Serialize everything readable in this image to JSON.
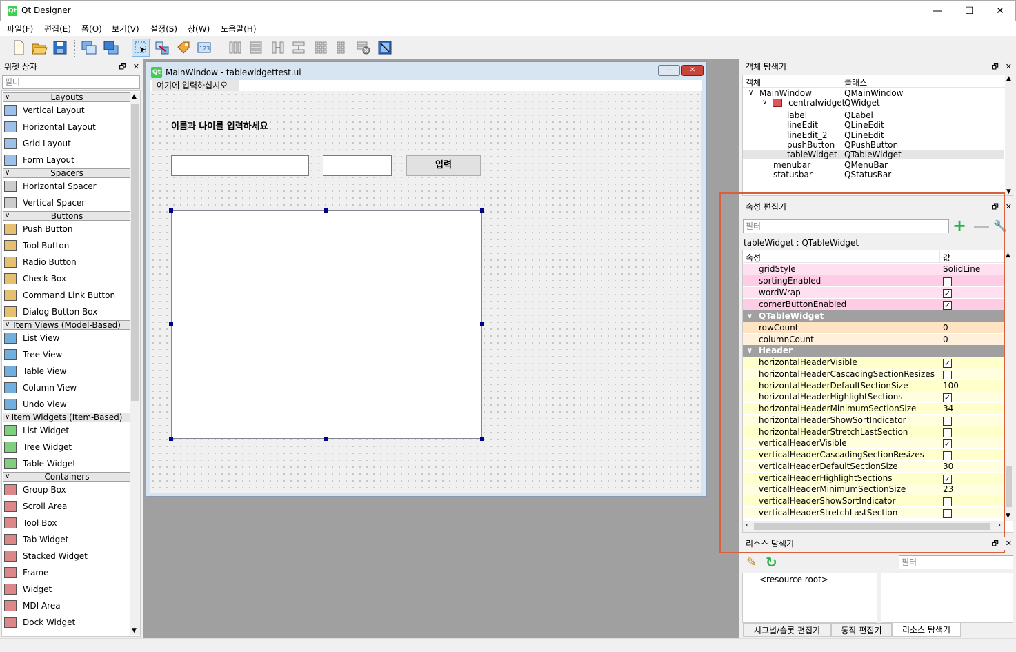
{
  "window": {
    "title": "Qt Designer",
    "min": "—",
    "max": "☐",
    "close": "✕"
  },
  "menu": [
    "파일(F)",
    "편집(E)",
    "폼(O)",
    "보기(V)",
    "설정(S)",
    "창(W)",
    "도움말(H)"
  ],
  "widget_box": {
    "title": "위젯 상자",
    "filter_placeholder": "필터",
    "categories": [
      {
        "label": "Layouts",
        "items": [
          "Vertical Layout",
          "Horizontal Layout",
          "Grid Layout",
          "Form Layout"
        ]
      },
      {
        "label": "Spacers",
        "items": [
          "Horizontal Spacer",
          "Vertical Spacer"
        ]
      },
      {
        "label": "Buttons",
        "items": [
          "Push Button",
          "Tool Button",
          "Radio Button",
          "Check Box",
          "Command Link Button",
          "Dialog Button Box"
        ]
      },
      {
        "label": "Item Views (Model-Based)",
        "items": [
          "List View",
          "Tree View",
          "Table View",
          "Column View",
          "Undo View"
        ]
      },
      {
        "label": "Item Widgets (Item-Based)",
        "items": [
          "List Widget",
          "Tree Widget",
          "Table Widget"
        ]
      },
      {
        "label": "Containers",
        "items": [
          "Group Box",
          "Scroll Area",
          "Tool Box",
          "Tab Widget",
          "Stacked Widget",
          "Frame",
          "Widget",
          "MDI Area",
          "Dock Widget"
        ]
      }
    ]
  },
  "form_window": {
    "title": "MainWindow - tablewidgettest.ui",
    "menu_placeholder": "여기에 입력하십시오",
    "label_text": "이름과 나이를 입력하세요",
    "button_text": "입력"
  },
  "object_inspector": {
    "title": "객체 탐색기",
    "col_object": "객체",
    "col_class": "클래스",
    "rows": [
      {
        "name": "MainWindow",
        "cls": "QMainWindow"
      },
      {
        "name": "centralwidget",
        "cls": "QWidget"
      },
      {
        "name": "label",
        "cls": "QLabel"
      },
      {
        "name": "lineEdit",
        "cls": "QLineEdit"
      },
      {
        "name": "lineEdit_2",
        "cls": "QLineEdit"
      },
      {
        "name": "pushButton",
        "cls": "QPushButton"
      },
      {
        "name": "tableWidget",
        "cls": "QTableWidget"
      },
      {
        "name": "menubar",
        "cls": "QMenuBar"
      },
      {
        "name": "statusbar",
        "cls": "QStatusBar"
      }
    ]
  },
  "property_editor": {
    "title": "속성 편집기",
    "filter_placeholder": "필터",
    "object_label": "tableWidget : QTableWidget",
    "col_property": "속성",
    "col_value": "값",
    "rows_a": [
      {
        "name": "gridStyle",
        "value": "SolidLine"
      },
      {
        "name": "sortingEnabled",
        "value": ""
      },
      {
        "name": "wordWrap",
        "value": "✓"
      },
      {
        "name": "cornerButtonEnabled",
        "value": "✓"
      }
    ],
    "group1": "QTableWidget",
    "rows_b": [
      {
        "name": "rowCount",
        "value": "0"
      },
      {
        "name": "columnCount",
        "value": "0"
      }
    ],
    "group2": "Header",
    "rows_c": [
      {
        "name": "horizontalHeaderVisible",
        "value": "✓"
      },
      {
        "name": "horizontalHeaderCascadingSectionResizes",
        "value": ""
      },
      {
        "name": "horizontalHeaderDefaultSectionSize",
        "value": "100"
      },
      {
        "name": "horizontalHeaderHighlightSections",
        "value": "✓"
      },
      {
        "name": "horizontalHeaderMinimumSectionSize",
        "value": "34"
      },
      {
        "name": "horizontalHeaderShowSortIndicator",
        "value": ""
      },
      {
        "name": "horizontalHeaderStretchLastSection",
        "value": ""
      },
      {
        "name": "verticalHeaderVisible",
        "value": "✓"
      },
      {
        "name": "verticalHeaderCascadingSectionResizes",
        "value": ""
      },
      {
        "name": "verticalHeaderDefaultSectionSize",
        "value": "30"
      },
      {
        "name": "verticalHeaderHighlightSections",
        "value": "✓"
      },
      {
        "name": "verticalHeaderMinimumSectionSize",
        "value": "23"
      },
      {
        "name": "verticalHeaderShowSortIndicator",
        "value": ""
      },
      {
        "name": "verticalHeaderStretchLastSection",
        "value": ""
      }
    ]
  },
  "resource_browser": {
    "title": "리소스 탐색기",
    "filter_placeholder": "필터",
    "root": "<resource root>"
  },
  "bottom_tabs": [
    "시그널/슬롯 편집기",
    "동작 편집기",
    "리소스 탐색기"
  ],
  "colors": {
    "pink": "#ffcce6",
    "pink_alt": "#ffe0f0",
    "orange": "#ffe4c4",
    "orange_alt": "#fff0dc",
    "yellow": "#ffffcc",
    "yellow_alt": "#ffffe0",
    "highlight_box": "#d9603b"
  }
}
